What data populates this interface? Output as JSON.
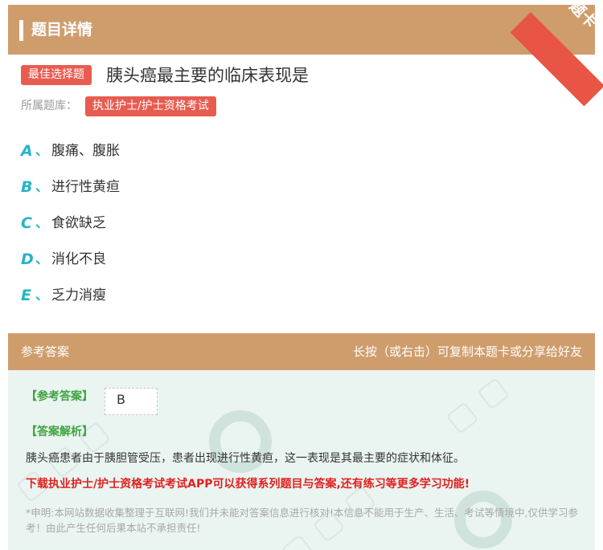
{
  "header": {
    "title": "题目详情",
    "corner_badge": "题卡"
  },
  "question": {
    "type_badge": "最佳选择题",
    "title": "胰头癌最主要的临床表现是",
    "bank_label": "所属题库：",
    "bank_name": "执业护士/护士资格考试"
  },
  "options": [
    {
      "letter": "A",
      "sep": "、",
      "text": "腹痛、腹胀"
    },
    {
      "letter": "B",
      "sep": "、",
      "text": "进行性黄疸"
    },
    {
      "letter": "C",
      "sep": "、",
      "text": "食欲缺乏"
    },
    {
      "letter": "D",
      "sep": "、",
      "text": "消化不良"
    },
    {
      "letter": "E",
      "sep": "、",
      "text": "乏力消瘦"
    }
  ],
  "answer_section": {
    "title": "参考答案",
    "hint": "长按（或右击）可复制本题卡或分享给好友",
    "answer_label": "【参考答案】",
    "answer_value": "B",
    "explanation_label": "【答案解析】",
    "explanation": "胰头癌患者由于胰胆管受压，患者出现进行性黄疸，这一表现是其最主要的症状和体征。",
    "promo": "下载执业护士/护士资格考试考试APP可以获得系列题目与答案,还有练习等更多学习功能!",
    "disclaimer": "*申明:本网站数据收集整理于互联网!我们并未能对答案信息进行核对!本信息不能用于生产、生活、考试等情境中,仅供学习参考！由此产生任何后果本站不承担责任!"
  }
}
